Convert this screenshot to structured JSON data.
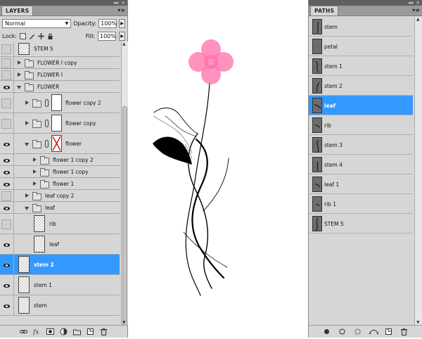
{
  "layers_panel": {
    "tab": "LAYERS",
    "blend_mode": "Normal",
    "opacity_label": "Opacity:",
    "opacity_value": "100%",
    "lock_label": "Lock:",
    "fill_label": "Fill:",
    "fill_value": "100%",
    "layers": [
      {
        "name": "STEM 5",
        "type": "layer",
        "visible": false,
        "indent": 0,
        "thumb": "checker"
      },
      {
        "name": "FLOWER I copy",
        "type": "group",
        "visible": false,
        "expanded": false,
        "indent": 0
      },
      {
        "name": "FLOWER I",
        "type": "group",
        "visible": false,
        "expanded": false,
        "indent": 0
      },
      {
        "name": "FLOWER",
        "type": "group",
        "visible": true,
        "expanded": true,
        "indent": 0
      },
      {
        "name": "flower copy 2",
        "type": "smartgroup",
        "visible": false,
        "expanded": false,
        "indent": 1
      },
      {
        "name": "flower copy",
        "type": "smartgroup",
        "visible": false,
        "expanded": false,
        "indent": 1
      },
      {
        "name": "flower",
        "type": "smartgroup",
        "visible": true,
        "expanded": true,
        "indent": 1,
        "mask": "x"
      },
      {
        "name": "flower 1 copy 2",
        "type": "group",
        "visible": true,
        "expanded": false,
        "indent": 2
      },
      {
        "name": "flower 1 copy",
        "type": "group",
        "visible": true,
        "expanded": false,
        "indent": 2
      },
      {
        "name": "flower 1",
        "type": "group",
        "visible": true,
        "expanded": false,
        "indent": 2
      },
      {
        "name": "leaf copy 2",
        "type": "group",
        "visible": false,
        "expanded": false,
        "indent": 1
      },
      {
        "name": "leaf",
        "type": "group",
        "visible": true,
        "expanded": true,
        "indent": 1
      },
      {
        "name": "rib",
        "type": "layer",
        "visible": false,
        "indent": 2,
        "thumb": "checker"
      },
      {
        "name": "leaf",
        "type": "layer",
        "visible": true,
        "indent": 2,
        "thumb": "checker"
      },
      {
        "name": "stem 2",
        "type": "layer",
        "visible": true,
        "indent": 0,
        "thumb": "checker",
        "selected": true
      },
      {
        "name": "stem 1",
        "type": "layer",
        "visible": true,
        "indent": 0,
        "thumb": "checker"
      },
      {
        "name": "stem",
        "type": "layer",
        "visible": true,
        "indent": 0,
        "thumb": "checker"
      }
    ]
  },
  "paths_panel": {
    "tab": "PATHS",
    "paths": [
      {
        "name": "stem"
      },
      {
        "name": "petal"
      },
      {
        "name": "stem 1"
      },
      {
        "name": "stem 2"
      },
      {
        "name": "leaf",
        "selected": true
      },
      {
        "name": "rib"
      },
      {
        "name": "stem 3"
      },
      {
        "name": "stem 4"
      },
      {
        "name": "leaf 1"
      },
      {
        "name": "rib 1"
      },
      {
        "name": "STEM 5"
      }
    ]
  },
  "colors": {
    "panel_bg": "#d6d6d6",
    "selection": "#3399ff",
    "petal": "#ff6ea8",
    "leaf": "#000000"
  }
}
